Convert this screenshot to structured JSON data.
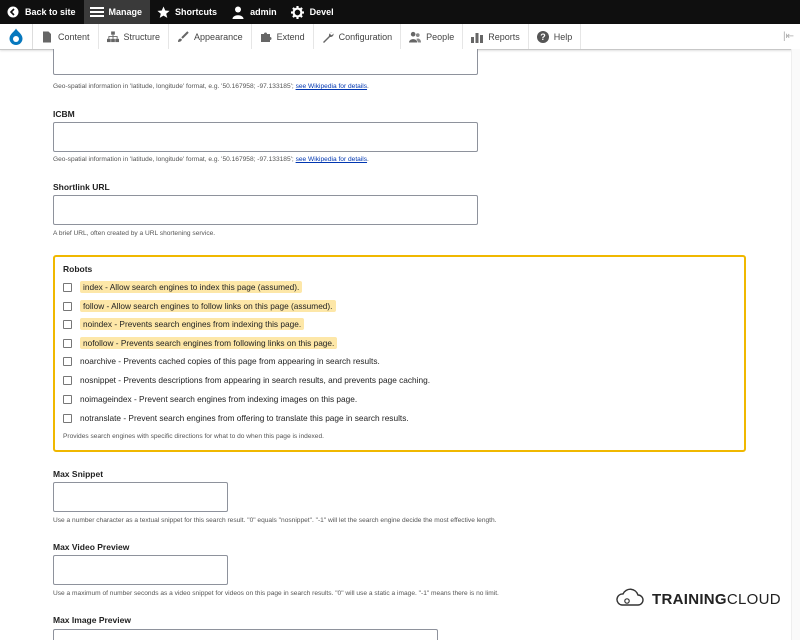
{
  "toolbar": {
    "back": "Back to site",
    "manage": "Manage",
    "shortcuts": "Shortcuts",
    "user": "admin",
    "devel": "Devel"
  },
  "tray": {
    "items": [
      "Content",
      "Structure",
      "Appearance",
      "Extend",
      "Configuration",
      "People",
      "Reports",
      "Help"
    ]
  },
  "form": {
    "geo_desc_prefix": "Geo-spatial information in 'latitude, longitude' format, e.g. '50.167958; -97.133185';",
    "geo_desc_link": "see Wikipedia for details",
    "icbm_label": "ICBM",
    "icbm_desc_prefix": "Geo-spatial information in 'latitude, longitude' format, e.g. '50.167958; -97.133185';",
    "icbm_desc_link": "see Wikipedia for details",
    "shortlink_label": "Shortlink URL",
    "shortlink_desc": "A brief URL, often created by a URL shortening service.",
    "robots": {
      "title": "Robots",
      "options": [
        "index - Allow search engines to index this page (assumed).",
        "follow - Allow search engines to follow links on this page (assumed).",
        "noindex - Prevents search engines from indexing this page.",
        "nofollow - Prevents search engines from following links on this page.",
        "noarchive - Prevents cached copies of this page from appearing in search results.",
        "nosnippet - Prevents descriptions from appearing in search results, and prevents page caching.",
        "noimageindex - Prevent search engines from indexing images on this page.",
        "notranslate - Prevent search engines from offering to translate this page in search results."
      ],
      "description": "Provides search engines with specific directions for what to do when this page is indexed."
    },
    "max_snippet_label": "Max Snippet",
    "max_snippet_desc": "Use a number character as a textual snippet for this search result. \"0\" equals \"nosnippet\". \"-1\" will let the search engine decide the most effective length.",
    "max_video_label": "Max Video Preview",
    "max_video_desc": "Use a maximum of number seconds as a video snippet for videos on this page in search results. \"0\" will use a static a image. \"-1\" means there is no limit.",
    "max_image_label": "Max Image Preview"
  },
  "watermark": {
    "bold": "TRAINING",
    "rest": "CLOUD"
  }
}
